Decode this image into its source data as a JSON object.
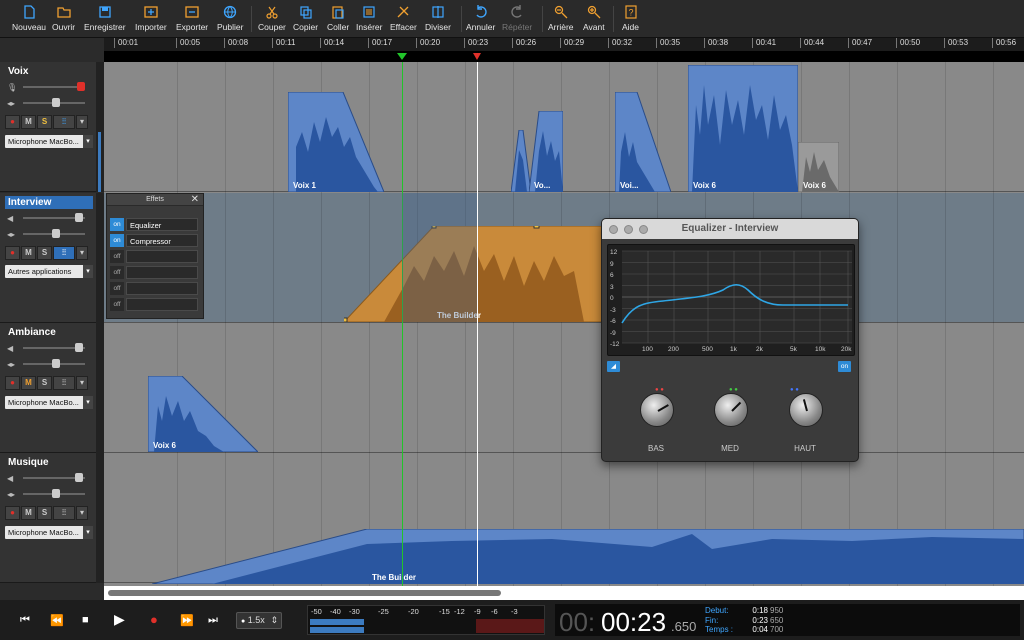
{
  "toolbar": {
    "items": [
      {
        "label": "Nouveau",
        "icon": "new-document-icon"
      },
      {
        "label": "Ouvrir",
        "icon": "folder-open-icon"
      },
      {
        "label": "Enregistrer",
        "icon": "save-icon"
      },
      {
        "label": "Importer",
        "icon": "import-icon"
      },
      {
        "label": "Exporter",
        "icon": "export-icon"
      },
      {
        "label": "Publier",
        "icon": "globe-icon"
      },
      {
        "label": "Couper",
        "icon": "scissors-icon"
      },
      {
        "label": "Copier",
        "icon": "copy-icon"
      },
      {
        "label": "Coller",
        "icon": "paste-icon"
      },
      {
        "label": "Insérer",
        "icon": "insert-icon"
      },
      {
        "label": "Effacer",
        "icon": "erase-icon"
      },
      {
        "label": "Diviser",
        "icon": "split-icon"
      },
      {
        "label": "Annuler",
        "icon": "undo-icon"
      },
      {
        "label": "Répéter",
        "icon": "redo-icon"
      },
      {
        "label": "Arrière",
        "icon": "zoom-out-icon"
      },
      {
        "label": "Avant",
        "icon": "zoom-in-icon"
      },
      {
        "label": "Aide",
        "icon": "help-icon"
      }
    ]
  },
  "ruler": {
    "ticks": [
      "00:01",
      "00:05",
      "00:08",
      "00:11",
      "00:14",
      "00:17",
      "00:20",
      "00:23",
      "00:26",
      "00:29",
      "00:32",
      "00:35",
      "00:38",
      "00:41",
      "00:44",
      "00:47",
      "00:50",
      "00:53",
      "00:56"
    ]
  },
  "tracks": [
    {
      "name": "Voix",
      "device": "Microphone MacBo...",
      "selected": false
    },
    {
      "name": "Interview",
      "device": "Autres applications",
      "selected": true
    },
    {
      "name": "Ambiance",
      "device": "Microphone MacBo...",
      "selected": false
    },
    {
      "name": "Musique",
      "device": "Microphone MacBo...",
      "selected": false
    }
  ],
  "track_buttons": {
    "mute": "M",
    "solo": "S"
  },
  "clips": {
    "voix_1": "Voix 1",
    "voix_a": "Vo...",
    "voix_b": "Voi...",
    "voix_6a": "Voix 6",
    "voix_6b": "Voix 6",
    "interview_builder": "The Builder",
    "ambiance_voix6": "Voix 6",
    "musique_builder": "The Builder"
  },
  "effects_panel": {
    "title": "Effets",
    "close": "✕",
    "rows": [
      {
        "state": "on",
        "name": "Equalizer"
      },
      {
        "state": "on",
        "name": "Compressor"
      },
      {
        "state": "off",
        "name": ""
      },
      {
        "state": "off",
        "name": ""
      },
      {
        "state": "off",
        "name": ""
      },
      {
        "state": "off",
        "name": ""
      }
    ]
  },
  "equalizer": {
    "title": "Equalizer - Interview",
    "y_ticks": [
      "12",
      "9",
      "6",
      "3",
      "0",
      "-3",
      "-6",
      "-9",
      "-12"
    ],
    "x_ticks": [
      "100",
      "200",
      "500",
      "1k",
      "2k",
      "5k",
      "10k",
      "20k"
    ],
    "on_label": "on",
    "knobs": [
      {
        "label": "BAS"
      },
      {
        "label": "MED"
      },
      {
        "label": "HAUT"
      }
    ],
    "curve_color": "#2ea6e6"
  },
  "transport": {
    "rate": "1.5x",
    "meter_labels": [
      "-50",
      "-40",
      "-30",
      "-25",
      "-20",
      "-15",
      "-12",
      "-9",
      "-6",
      "-3"
    ],
    "clock_prefix": "00:",
    "clock_main": "00:23",
    "clock_frac": ".650",
    "debut_label": "Debut:",
    "debut_value": "0:18",
    "debut_ms": "950",
    "fin_label": "Fin:",
    "fin_value": "0:23",
    "fin_ms": "650",
    "temps_label": "Temps :",
    "temps_value": "0:04",
    "temps_ms": "700"
  },
  "colors": {
    "clip_blue": "#3a6db8",
    "clip_orange": "#c98a3a",
    "selected_track": "#2f6fb8",
    "record_red": "#e0302a",
    "playhead_green": "#21c42a"
  }
}
